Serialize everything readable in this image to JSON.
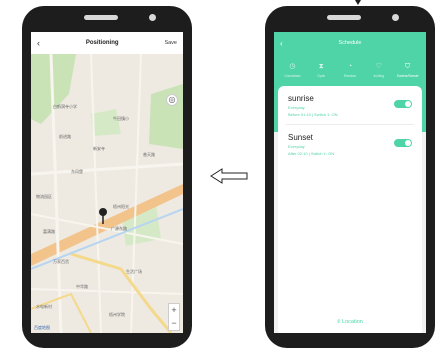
{
  "left_phone": {
    "header": {
      "back_icon": "chevron-left-icon",
      "title": "Positioning",
      "save_label": "Save"
    },
    "map": {
      "labels": [
        "白鹤洞寺小学",
        "前进路",
        "牛田镇小",
        "新安寺",
        "普天路",
        "东风堡",
        "物流园区",
        "梧州阳光",
        "广源东路",
        "富满路",
        "万家百货",
        "生活广场",
        "中华路",
        "水电新村",
        "梧州学院"
      ],
      "attribution": "百度地图"
    }
  },
  "right_phone": {
    "header": {
      "back_icon": "chevron-left-icon",
      "title": "Schedule"
    },
    "tabs": [
      {
        "icon": "clock-icon",
        "label": "Countdown",
        "active": false
      },
      {
        "icon": "hourglass-icon",
        "label": "Cycle",
        "active": false
      },
      {
        "icon": "timer-icon",
        "label": "Random",
        "active": false
      },
      {
        "icon": "heart-icon",
        "label": "Inching",
        "active": false
      },
      {
        "icon": "shield-icon",
        "label": "Sunrise/Sunset",
        "active": true
      }
    ],
    "items": [
      {
        "name": "sunrise",
        "repeat": "Everyday",
        "detail": "Before 01:10  | Switch 1: ON",
        "enabled": true
      },
      {
        "name": "Sunset",
        "repeat": "Everyday",
        "detail": "After 02:10  | Switch 1: ON",
        "enabled": true
      }
    ],
    "location_label": "Location"
  },
  "colors": {
    "accent": "#4fd4a7",
    "phone_body": "#1d1d1d"
  }
}
